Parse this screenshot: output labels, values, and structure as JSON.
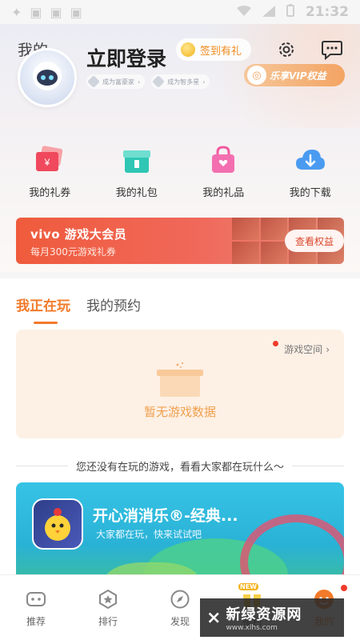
{
  "status_bar": {
    "time": "21:32"
  },
  "header": {
    "my_label": "我的",
    "login_title": "立即登录",
    "signin_pill": "签到有礼",
    "level_chips": [
      "成为富豪家",
      "成为智多星"
    ],
    "vip_tag": "乐享VIP权益"
  },
  "quick_actions": [
    {
      "label": "我的礼券",
      "icon": "coupon-icon"
    },
    {
      "label": "我的礼包",
      "icon": "gift-box-icon"
    },
    {
      "label": "我的礼品",
      "icon": "shopping-bag-icon"
    },
    {
      "label": "我的下载",
      "icon": "cloud-download-icon"
    }
  ],
  "vip_banner": {
    "title": "vivo 游戏大会员",
    "subtitle": "每月300元游戏礼券",
    "button": "查看权益"
  },
  "tabs": [
    {
      "label": "我正在玩",
      "active": true
    },
    {
      "label": "我的预约",
      "active": false
    }
  ],
  "playing": {
    "game_space": "游戏空间",
    "empty_text": "暂无游戏数据"
  },
  "divider_text": "您还没有在玩的游戏，看看大家都在玩什么～",
  "featured_game": {
    "title": "开心消消乐®-经典...",
    "subtitle": "大家都在玩，快来试试吧"
  },
  "bottom_nav": [
    {
      "label": "推荐",
      "icon": "gamepad-icon",
      "active": false
    },
    {
      "label": "排行",
      "icon": "ranking-icon",
      "active": false
    },
    {
      "label": "发现",
      "icon": "compass-icon",
      "active": false
    },
    {
      "label": "福利",
      "icon": "gift-icon",
      "active": false
    },
    {
      "label": "我的",
      "icon": "profile-icon",
      "active": true
    }
  ],
  "watermark": {
    "title": "新绿资源网",
    "url": "www.xlhs.com"
  },
  "colors": {
    "accent": "#f27a2a",
    "vip_red": "#ef5b3c",
    "empty_text": "#f0a04e"
  }
}
